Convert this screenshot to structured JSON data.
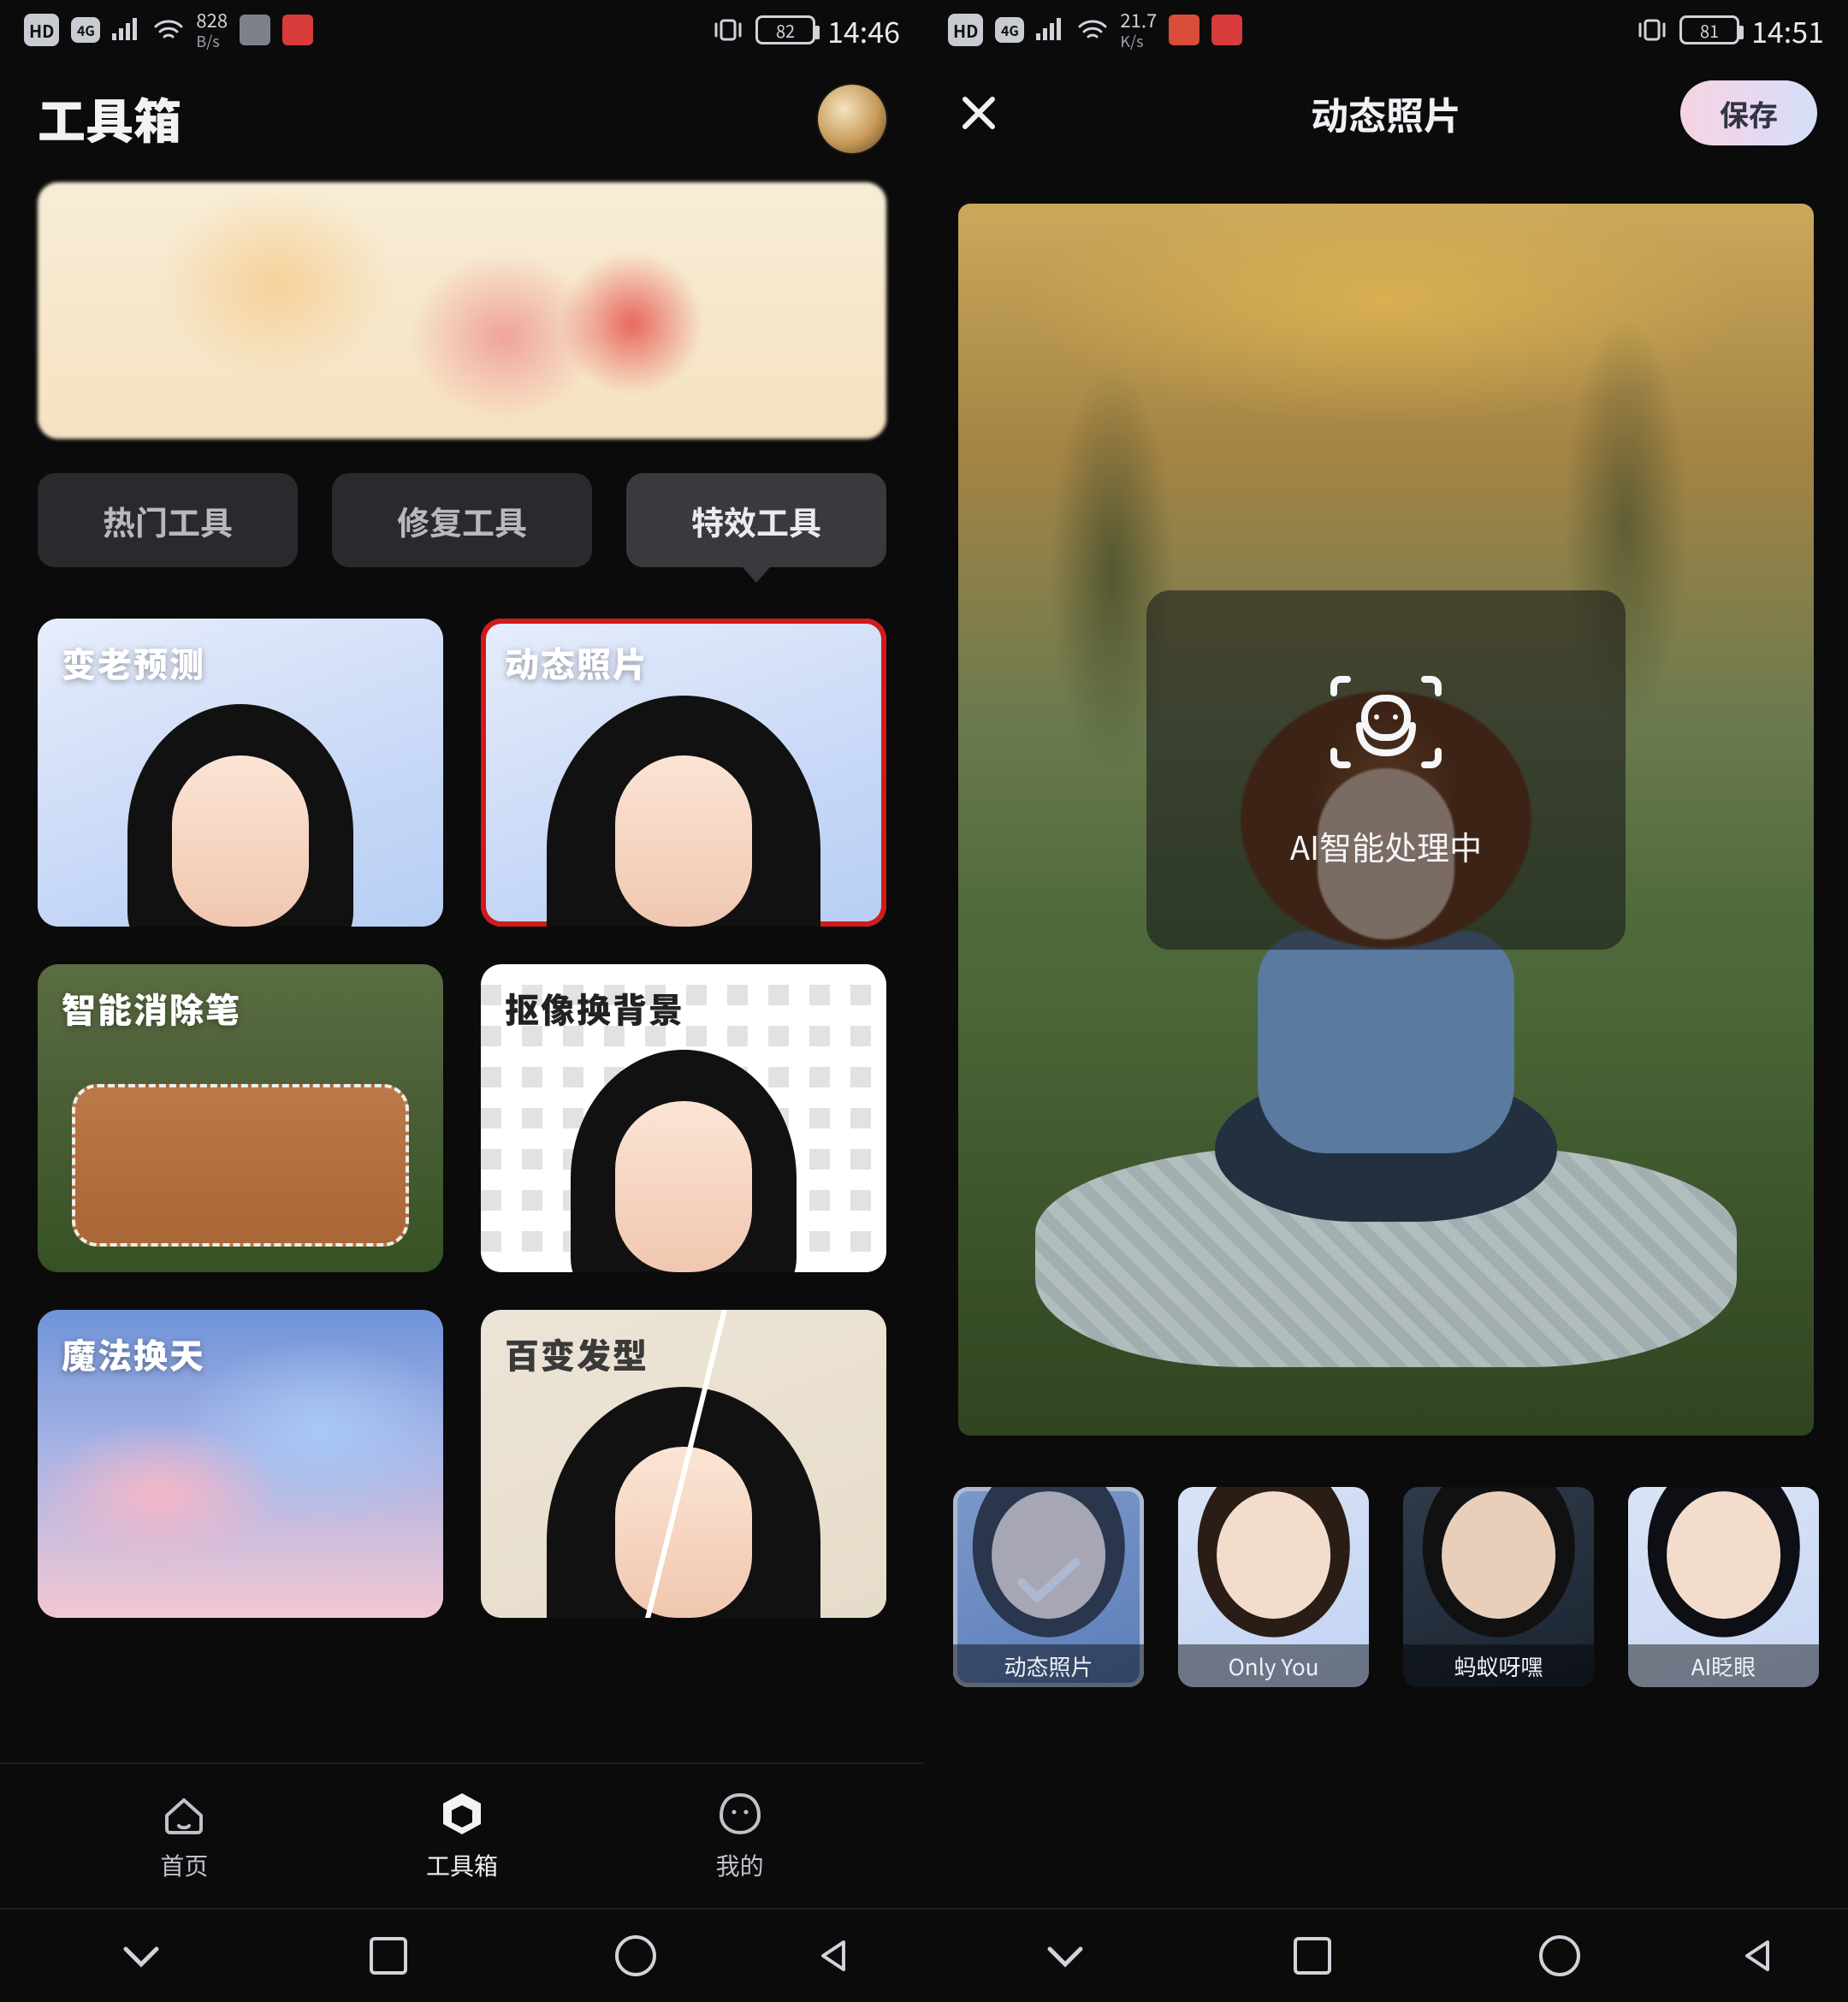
{
  "left": {
    "status": {
      "hd": "HD",
      "net": "4G",
      "speed_value": "828",
      "speed_unit": "B/s",
      "battery_pct": "82",
      "time": "14:46"
    },
    "title": "工具箱",
    "tabs": {
      "hot": "热门工具",
      "repair": "修复工具",
      "effects": "特效工具"
    },
    "cards": {
      "aging": "变老预测",
      "live_photo": "动态照片",
      "eraser": "智能消除笔",
      "bg_swap": "抠像换背景",
      "sky": "魔法换天",
      "hair": "百变发型"
    },
    "dock": {
      "home": "首页",
      "toolbox": "工具箱",
      "me": "我的"
    }
  },
  "right": {
    "status": {
      "hd": "HD",
      "net": "4G",
      "speed_value": "21.7",
      "speed_unit": "K/s",
      "battery_pct": "81",
      "time": "14:51"
    },
    "title": "动态照片",
    "save": "保存",
    "processing": "AI智能处理中",
    "thumbs": {
      "t1": "动态照片",
      "t2": "Only You",
      "t3": "蚂蚁呀嘿",
      "t4": "AI眨眼"
    }
  }
}
